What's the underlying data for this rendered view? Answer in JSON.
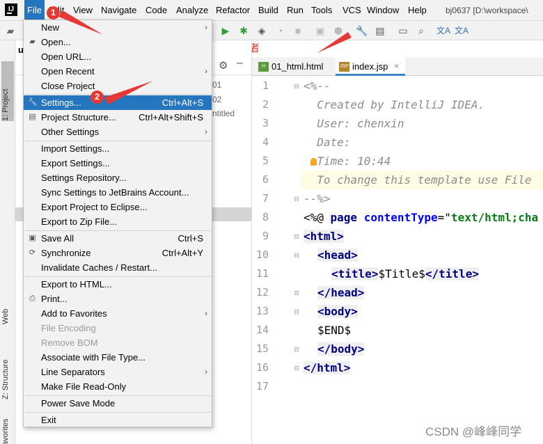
{
  "menubar": {
    "items": [
      "File",
      "Edit",
      "View",
      "Navigate",
      "Code",
      "Analyze",
      "Refactor",
      "Build",
      "Run",
      "Tools",
      "VCS",
      "Window",
      "Help"
    ],
    "project_title": "bj0637 [D:\\workspace\\"
  },
  "toolbar": {
    "icons": [
      "folder-icon",
      "run-icon",
      "debug-icon",
      "coverage-icon",
      "profile-icon",
      "stop-icon",
      "build-icon",
      "ant-icon",
      "settings-wrench-icon",
      "project-structure-icon",
      "terminal-icon",
      "search-icon",
      "translate-icon",
      "translate-alt-icon"
    ]
  },
  "annotation": {
    "hint": "或者",
    "badge1": "1",
    "badge2": "2",
    "watermark": "CSDN @峰峰同学",
    "accent": "#e53935"
  },
  "left_stripe": {
    "project_tab": "1: Project",
    "web_tab": "Web",
    "structure_tab": "Z: Structure",
    "favorites_tab": "avorites"
  },
  "project_panel": {
    "partial_texts": [
      "01",
      "02",
      "ntitled"
    ],
    "partial_root": "u"
  },
  "editor": {
    "tabs": [
      {
        "label": "01_html.html",
        "icon": "H",
        "icon_color": "#5a9a3a"
      },
      {
        "label": "index.jsp",
        "icon": "JSP",
        "icon_color": "#b5832a"
      }
    ],
    "line_numbers": [
      "1",
      "2",
      "3",
      "4",
      "5",
      "6",
      "7",
      "8",
      "9",
      "10",
      "11",
      "12",
      "13",
      "14",
      "15",
      "16",
      "17"
    ]
  },
  "code": {
    "l1": "<%--",
    "l2": "  Created by IntelliJ IDEA.",
    "l3": "  User: chenxin",
    "l4": "  Date:",
    "l5": "  Time: 10:44",
    "l6": "  To change this template use File",
    "l7": "--%>",
    "l8_a": "<%@ ",
    "l8_b": "page ",
    "l8_c": "contentType",
    "l8_d": "=\"",
    "l8_e": "text/html;cha",
    "l9": "html",
    "l10": "head",
    "l11_tag": "title",
    "l11_text": "$Title$",
    "l12": "head",
    "l13": "body",
    "l14": "$END$",
    "l15": "body",
    "l16": "html",
    "lt": "<",
    "gt": ">",
    "lts": "</"
  },
  "file_menu": {
    "items": [
      {
        "label": "New",
        "arrow": "›"
      },
      {
        "label": "Open..."
      },
      {
        "label": "Open URL..."
      },
      {
        "label": "Open Recent",
        "arrow": "›"
      },
      {
        "label": "Close Project"
      },
      {
        "label": "Settings...",
        "shortcut": "Ctrl+Alt+S"
      },
      {
        "label": "Project Structure...",
        "shortcut": "Ctrl+Alt+Shift+S"
      },
      {
        "label": "Other Settings",
        "arrow": "›"
      },
      {
        "label": "Import Settings..."
      },
      {
        "label": "Export Settings..."
      },
      {
        "label": "Settings Repository..."
      },
      {
        "label": "Sync Settings to JetBrains Account..."
      },
      {
        "label": "Export Project to Eclipse..."
      },
      {
        "label": "Export to Zip File..."
      },
      {
        "label": "Save All",
        "shortcut": "Ctrl+S"
      },
      {
        "label": "Synchronize",
        "shortcut": "Ctrl+Alt+Y"
      },
      {
        "label": "Invalidate Caches / Restart..."
      },
      {
        "label": "Export to HTML..."
      },
      {
        "label": "Print..."
      },
      {
        "label": "Add to Favorites",
        "arrow": "›"
      },
      {
        "label": "File Encoding"
      },
      {
        "label": "Remove BOM"
      },
      {
        "label": "Associate with File Type..."
      },
      {
        "label": "Line Separators",
        "arrow": "›"
      },
      {
        "label": "Make File Read-Only"
      },
      {
        "label": "Power Save Mode"
      },
      {
        "label": "Exit"
      }
    ]
  }
}
